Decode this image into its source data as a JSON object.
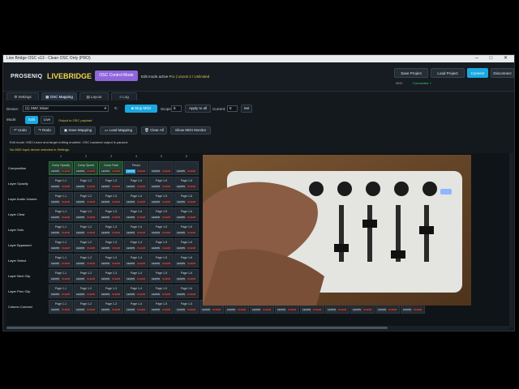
{
  "window": {
    "title": "Live Bridge OSC  v13  -  Clean OSC Only  (PRO)",
    "controls": "─ □ ✕"
  },
  "header": {
    "brand_primary": "PROSENIQ",
    "brand_secondary": "LIVEBRIDGE",
    "osc_mode_button": "OSC Control Mode",
    "edit_mode_label": "Edit mode active",
    "plan_label": "Pro | Unock 2 / Unlimited",
    "buttons": {
      "save_project": "Save Project",
      "load_project": "Load Project",
      "connect": "Connect",
      "disconnect": "Disconnect"
    },
    "status_midi": "MIDI",
    "status_connected": "Connected ✓"
  },
  "tabs": [
    {
      "label": "Settings",
      "icon": "gear-icon"
    },
    {
      "label": "OSC Mapping",
      "icon": "grid-icon"
    },
    {
      "label": "Layout",
      "icon": "layout-icon"
    },
    {
      "label": "Log",
      "icon": "log-icon"
    }
  ],
  "device_row": {
    "device_label": "Device:",
    "device_value": "(1) SMC Mixer",
    "stop_midi": "Stop MIDI",
    "scope_label": "Scope:",
    "scope_value": "8",
    "apply_all": "Apply to all",
    "current_label": "Current:",
    "current_value": "8",
    "set_button": "Set"
  },
  "mode_row": {
    "mode_label": "Mode:",
    "edit": "Edit",
    "live": "Live",
    "output_note": "Output to OSC payload"
  },
  "action_row": {
    "undo": "Undo",
    "redo": "Redo",
    "save_mapping": "Save Mapping",
    "load_mapping": "Load Mapping",
    "clear_all": "Clear All",
    "show_midi_monitor": "Show MIDI Monitor"
  },
  "info_line": "Edit mode: MIDI Learn and target editing enabled. OSC backend output is paused.",
  "warning_line": "No MIDI input device selected in Settings.",
  "grid": {
    "columns": [
      "1",
      "2",
      "3",
      "4",
      "5",
      "6"
    ],
    "rows": [
      {
        "label": "Composition",
        "cells": [
          "Comp Opacity",
          "Comp Speed",
          "Comp Fade",
          "Tempo",
          "",
          ""
        ]
      },
      {
        "label": "Layer Opacity",
        "cells": [
          "Page 1-1",
          "Page 1-2",
          "Page 1-3",
          "Page 1-4",
          "Page 1-5",
          "Page 1-6"
        ]
      },
      {
        "label": "Layer Audio Volume",
        "cells": [
          "Page 1-1",
          "Page 1-2",
          "Page 1-3",
          "Page 1-4",
          "Page 1-5",
          "Page 1-6"
        ]
      },
      {
        "label": "Layer Clear",
        "cells": [
          "Page 1-1",
          "Page 1-2",
          "Page 1-3",
          "Page 1-4",
          "Page 1-5",
          "Page 1-6"
        ]
      },
      {
        "label": "Layer Solo",
        "cells": [
          "Page 1-1",
          "Page 1-2",
          "Page 1-3",
          "Page 1-4",
          "Page 1-5",
          "Page 1-6"
        ]
      },
      {
        "label": "Layer Bypassed",
        "cells": [
          "Page 1-1",
          "Page 1-2",
          "Page 1-3",
          "Page 1-4",
          "Page 1-5",
          "Page 1-6"
        ]
      },
      {
        "label": "Layer Select",
        "cells": [
          "Page 1-1",
          "Page 1-2",
          "Page 1-3",
          "Page 1-4",
          "Page 1-5",
          "Page 1-6"
        ]
      },
      {
        "label": "Layer Next Clip",
        "cells": [
          "Page 1-1",
          "Page 1-2",
          "Page 1-3",
          "Page 1-4",
          "Page 1-5",
          "Page 1-6"
        ]
      },
      {
        "label": "Layer Prev Clip",
        "cells": [
          "Page 1-1",
          "Page 1-2",
          "Page 1-3",
          "Page 1-4",
          "Page 1-5",
          "Page 1-6"
        ]
      },
      {
        "label": "Column Connect",
        "cells": [
          "Page 1-1",
          "Page 1-2",
          "Page 1-3",
          "Page 1-4",
          "Page 1-5",
          "Page 1-6"
        ]
      }
    ],
    "extra_bottom_cells": [
      "Page 1-7",
      "Page 1-8",
      "Page 1-9",
      "Page 1-10",
      "Page 1-11",
      "Page 1-12",
      "Page 1-13",
      "Page 1-14",
      "Page 1-15"
    ],
    "learn_label": "LEARN",
    "clear_label": "CLEAR"
  },
  "colors": {
    "accent_blue": "#1aa8e0",
    "brand_yellow": "#f2d64b",
    "osc_purple": "#8f66dc",
    "ok_green": "#39d06d",
    "mapped_green": "#1f4a2e"
  }
}
